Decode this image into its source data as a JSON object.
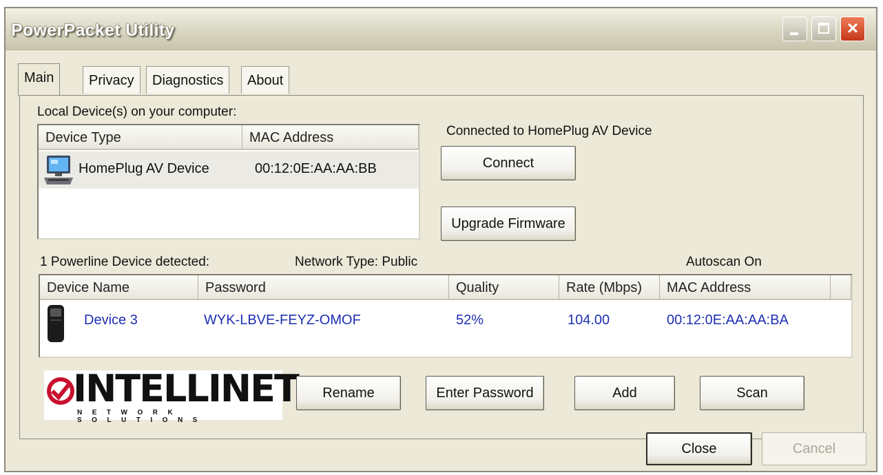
{
  "window": {
    "title": "PowerPacket Utility",
    "buttons": {
      "minimize": "minimize",
      "maximize": "maximize",
      "close": "×"
    }
  },
  "tabs": [
    {
      "label": "Main",
      "active": true
    },
    {
      "label": "Privacy",
      "active": false
    },
    {
      "label": "Diagnostics",
      "active": false
    },
    {
      "label": "About",
      "active": false
    }
  ],
  "local": {
    "heading": "Local Device(s) on your computer:",
    "columns": [
      "Device Type",
      "MAC Address"
    ],
    "rows": [
      {
        "icon": "computer-icon",
        "type": "HomePlug AV Device",
        "mac": "00:12:0E:AA:AA:BB"
      }
    ],
    "status": "Connected to HomePlug AV Device",
    "connect_label": "Connect",
    "upgrade_label": "Upgrade Firmware"
  },
  "powerline": {
    "detected": "1 Powerline Device detected:",
    "network_type": "Network Type: Public",
    "autoscan": "Autoscan On",
    "columns": [
      "Device Name",
      "Password",
      "Quality",
      "Rate (Mbps)",
      "MAC Address"
    ],
    "rows": [
      {
        "icon": "powerline-adapter-icon",
        "name": "Device 3",
        "password": "WYK-LBVE-FEYZ-OMOF",
        "quality": "52%",
        "rate": "104.00",
        "mac": "00:12:0E:AA:AA:BA"
      }
    ],
    "row_text_color": "#1f2fb2"
  },
  "logo": {
    "name": "INTELLINET",
    "sub": "NETWORK SOLUTIONS",
    "accent": "#c8102e"
  },
  "actions": {
    "rename": "Rename",
    "enter_password": "Enter Password",
    "add": "Add",
    "scan": "Scan"
  },
  "footer": {
    "close": "Close",
    "cancel": "Cancel"
  }
}
